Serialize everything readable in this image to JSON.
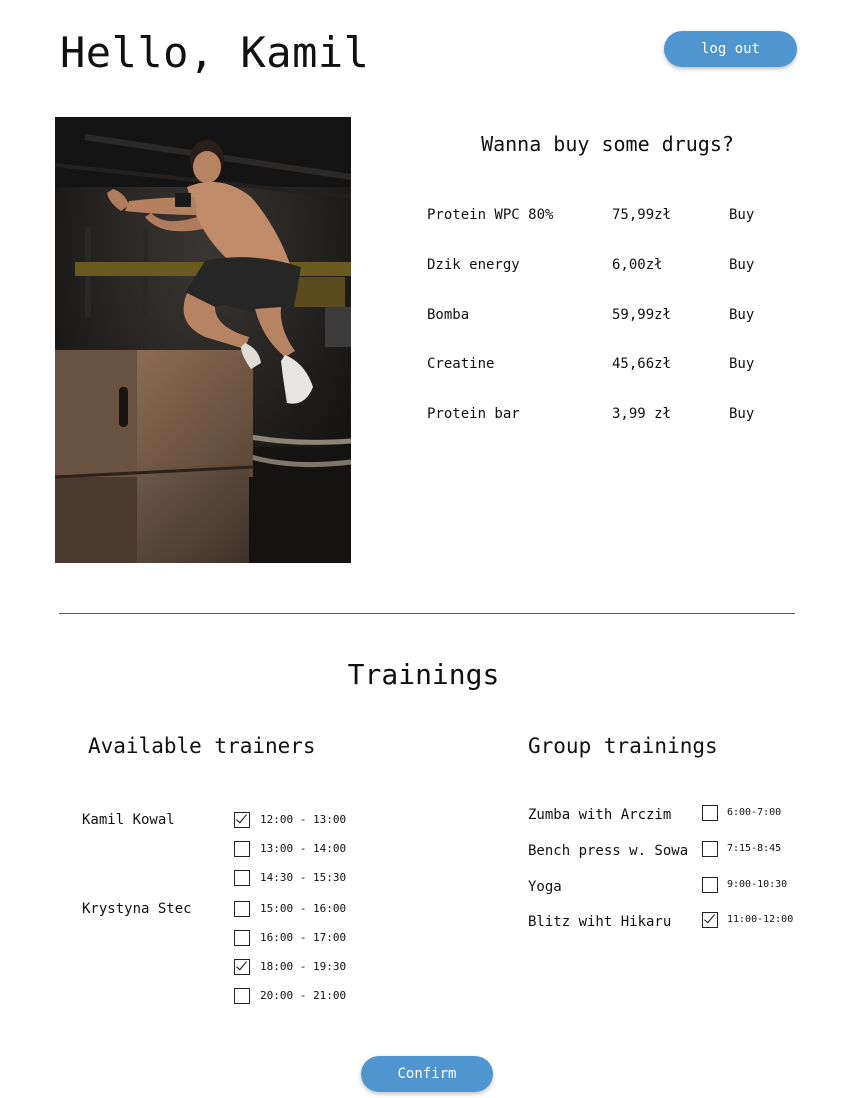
{
  "header": {
    "greeting": "Hello, Kamil",
    "logout_label": "log out"
  },
  "colors": {
    "accent": "#4f95d0"
  },
  "shop": {
    "title": "Wanna buy some drugs?",
    "products": [
      {
        "name": "Protein WPC 80%",
        "price": "75,99zł",
        "action": "Buy"
      },
      {
        "name": "Dzik energy",
        "price": "6,00zł",
        "action": "Buy"
      },
      {
        "name": "Bomba",
        "price": "59,99zł",
        "action": "Buy"
      },
      {
        "name": "Creatine",
        "price": "45,66zł",
        "action": "Buy"
      },
      {
        "name": "Protein bar",
        "price": "3,99 zł",
        "action": "Buy"
      }
    ]
  },
  "trainings": {
    "title": "Trainings",
    "trainers_title": "Available trainers",
    "trainers": [
      {
        "name": "Kamil Kowal"
      },
      {
        "name": "Krystyna Stec"
      }
    ],
    "slots": [
      {
        "time": "12:00 - 13:00",
        "checked": true
      },
      {
        "time": "13:00 - 14:00",
        "checked": false
      },
      {
        "time": "14:30 - 15:30",
        "checked": false
      },
      {
        "time": "15:00 - 16:00",
        "checked": false
      },
      {
        "time": "16:00 - 17:00",
        "checked": false
      },
      {
        "time": "18:00 - 19:30",
        "checked": true
      },
      {
        "time": "20:00 - 21:00",
        "checked": false
      }
    ],
    "group_title": "Group trainings",
    "groups": [
      {
        "name": "Zumba with Arczim",
        "time": "6:00-7:00",
        "checked": false
      },
      {
        "name": "Bench press w. Sowa",
        "time": "7:15-8:45",
        "checked": false
      },
      {
        "name": "Yoga",
        "time": "9:00-10:30",
        "checked": false
      },
      {
        "name": "Blitz wiht Hikaru",
        "time": "11:00-12:00",
        "checked": true
      }
    ],
    "confirm_label": "Confirm"
  }
}
